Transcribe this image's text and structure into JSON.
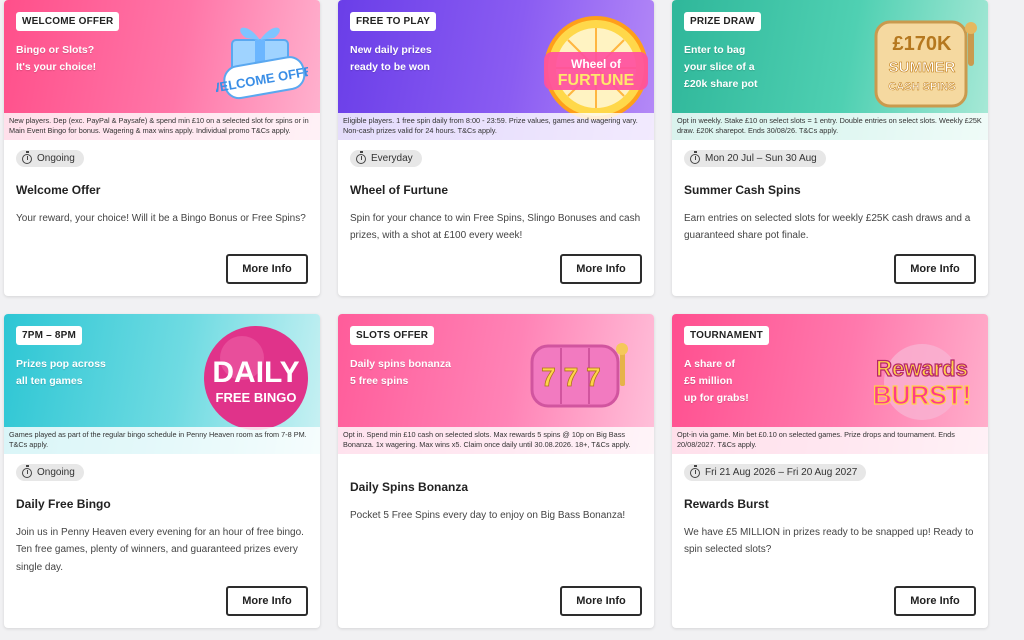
{
  "colors": {
    "page_bg": "#f1f1f3",
    "button_border": "#2d2d2d"
  },
  "promos": [
    {
      "tag": "WELCOME OFFER",
      "headline_1": "Bingo or Slots?",
      "headline_2": "It's your choice!",
      "art_text": "WELCOME OFFER",
      "art_icon": "gift-box-icon",
      "terms": "New players. Dep (exc. PayPal & Paysafe) & spend min £10 on a selected slot for spins or in Main Event Bingo for bonus. Wagering & max wins apply. Individual promo T&Cs apply.",
      "schedule": "Ongoing",
      "title": "Welcome Offer",
      "description": "Your reward, your choice! Will it be a Bingo Bonus or Free Spins?",
      "button": "More Info"
    },
    {
      "tag": "FREE TO PLAY",
      "headline_1": "New daily prizes",
      "headline_2": "ready to be won",
      "art_text": "Wheel of FURTUNE",
      "art_icon": "prize-wheel-icon",
      "terms": "Eligible players. 1 free spin daily from 8:00 - 23:59. Prize values, games and wagering vary. Non-cash prizes valid for 24 hours. T&Cs apply.",
      "schedule": "Everyday",
      "title": "Wheel of Furtune",
      "description": "Spin for your chance to win Free Spins, Slingo Bonuses and cash prizes, with a shot at £100 every week!",
      "button": "More Info"
    },
    {
      "tag": "PRIZE DRAW",
      "headline_1": "Enter to bag",
      "headline_2": "your slice of a",
      "headline_3": "£20k share pot",
      "art_text_1": "£170K",
      "art_text_2": "SUMMER",
      "art_text_3": "CASH SPINS",
      "art_icon": "slot-reel-icon",
      "terms": "Opt in weekly. Stake £10 on select slots = 1 entry. Double entries on select slots. Weekly £25K draw. £20K sharepot. Ends 30/08/26. T&Cs apply.",
      "schedule": "Mon 20 Jul – Sun 30 Aug",
      "title": "Summer Cash Spins",
      "description": "Earn entries on selected slots for weekly £25K cash draws and a guaranteed share pot finale.",
      "button": "More Info"
    },
    {
      "tag": "7PM – 8PM",
      "headline_1": "Prizes pop across",
      "headline_2": "all ten games",
      "art_text_1": "DAILY",
      "art_text_2": "FREE BINGO",
      "art_icon": "bingo-ball-icon",
      "terms": "Games played as part of the regular bingo schedule in Penny Heaven room as from 7-8 PM. T&Cs apply.",
      "schedule": "Ongoing",
      "title": "Daily Free Bingo",
      "description": "Join us in Penny Heaven every evening for an hour of free bingo. Ten free games, plenty of winners, and guaranteed prizes every single day.",
      "button": "More Info"
    },
    {
      "tag": "SLOTS OFFER",
      "headline_1": "Daily spins bonanza",
      "headline_2": "5 free spins",
      "art_text": "777",
      "art_icon": "slot-machine-icon",
      "terms": "Opt in. Spend min £10 cash on selected slots. Max rewards 5 spins @ 10p on Big Bass Bonanza. 1x wagering. Max wins x5. Claim once daily until 30.08.2026. 18+, T&Cs apply.",
      "title": "Daily Spins Bonanza",
      "description": "Pocket 5 Free Spins every day to enjoy on Big Bass Bonanza!",
      "button": "More Info"
    },
    {
      "tag": "TOURNAMENT",
      "headline_1": "A share of",
      "headline_2": "£5 million",
      "headline_3": "up for grabs!",
      "art_text_1": "Rewards",
      "art_text_2": "BURST!",
      "art_icon": "rewards-burst-icon",
      "terms": "Opt-in via game. Min bet £0.10 on selected games. Prize drops and tournament. Ends 20/08/2027. T&Cs apply.",
      "schedule": "Fri 21 Aug 2026 – Fri 20 Aug 2027",
      "title": "Rewards Burst",
      "description": "We have £5 MILLION in prizes ready to be snapped up! Ready to spin selected slots?",
      "button": "More Info"
    }
  ]
}
